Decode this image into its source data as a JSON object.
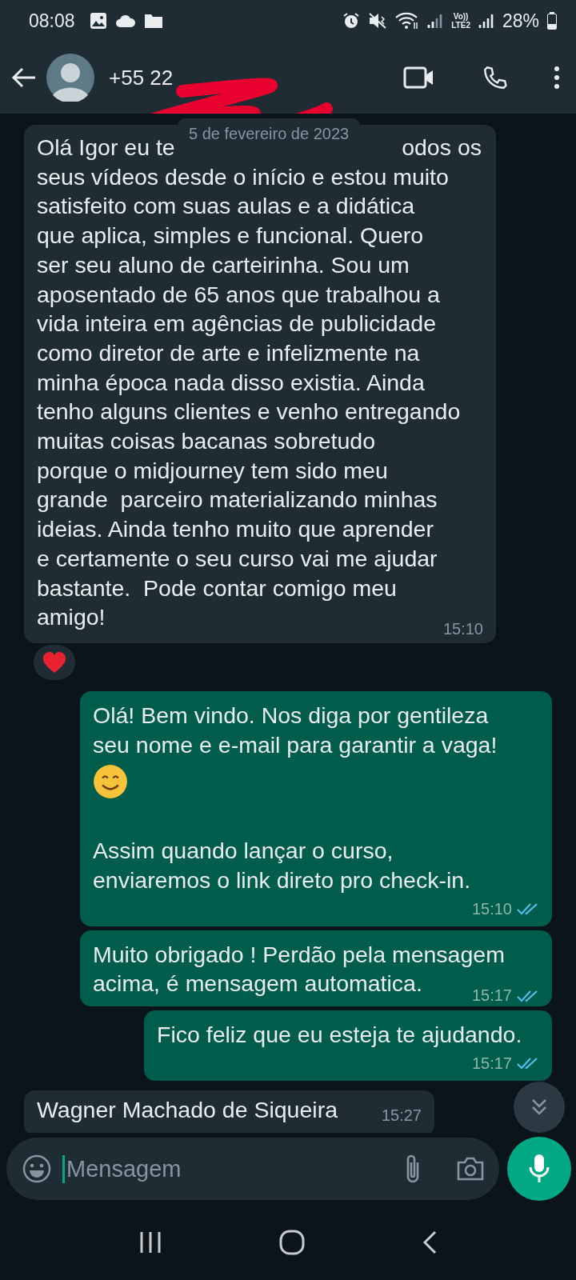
{
  "status_bar": {
    "time": "08:08",
    "volte": "Vo))",
    "network": "LTE2",
    "battery": "28%"
  },
  "header": {
    "title": "+55 22",
    "redacted": true
  },
  "date_chip": "5 de fevereiro de 2023",
  "messages": [
    {
      "kind": "incoming",
      "first_line": [
        "Olá Igor eu te",
        "odos os"
      ],
      "parts": [
        {
          "kind": "text",
          "text": "seus vídeos desde o início e estou muito\nsatisfeito com suas aulas e a didática\nque aplica, simples e funcional. Quero\nser seu aluno de carteirinha. Sou um\naposentado de 65 anos que trabalhou a\nvida inteira em agências de publicidade\ncomo diretor de arte e infelizmente na\nminha época nada disso existia. Ainda\ntenho alguns clientes e venho entregando\nmuitas coisas bacanas sobretudo\nporque o midjourney tem sido meu\ngrande  parceiro materializando minhas\nideias. Ainda tenho muito que aprender\ne certamente o seu curso vai me ajudar\nbastante.  Pode contar comigo meu\namigo!"
        }
      ],
      "time": "15:10",
      "reaction": {
        "kind": "heart"
      }
    },
    {
      "kind": "outgoing",
      "parts": [
        {
          "kind": "text",
          "text": "Olá! Bem vindo. Nos diga por gentileza\nseu nome e e-mail para garantir a vaga!"
        },
        {
          "kind": "emoji"
        },
        {
          "kind": "text",
          "text": "Assim quando lançar o curso,\nenviaremos o link direto pro check-in."
        }
      ],
      "time": "15:10",
      "read": true,
      "time_below": true
    },
    {
      "kind": "outgoing",
      "parts": [
        {
          "kind": "text",
          "text": "Muito obrigado ! Perdão pela mensagem\nacima, é mensagem automatica."
        }
      ],
      "time": "15:17",
      "read": true,
      "time_below": false
    },
    {
      "kind": "outgoing",
      "parts": [
        {
          "kind": "text",
          "text": "Fico feliz que eu esteja te ajudando."
        }
      ],
      "time": "15:17",
      "read": true,
      "time_below": true
    },
    {
      "kind": "incoming",
      "parts": [
        {
          "kind": "text",
          "text": "Wagner Machado de Siqueira"
        }
      ],
      "time": "15:27"
    }
  ],
  "composer": {
    "placeholder": "Mensagem"
  }
}
